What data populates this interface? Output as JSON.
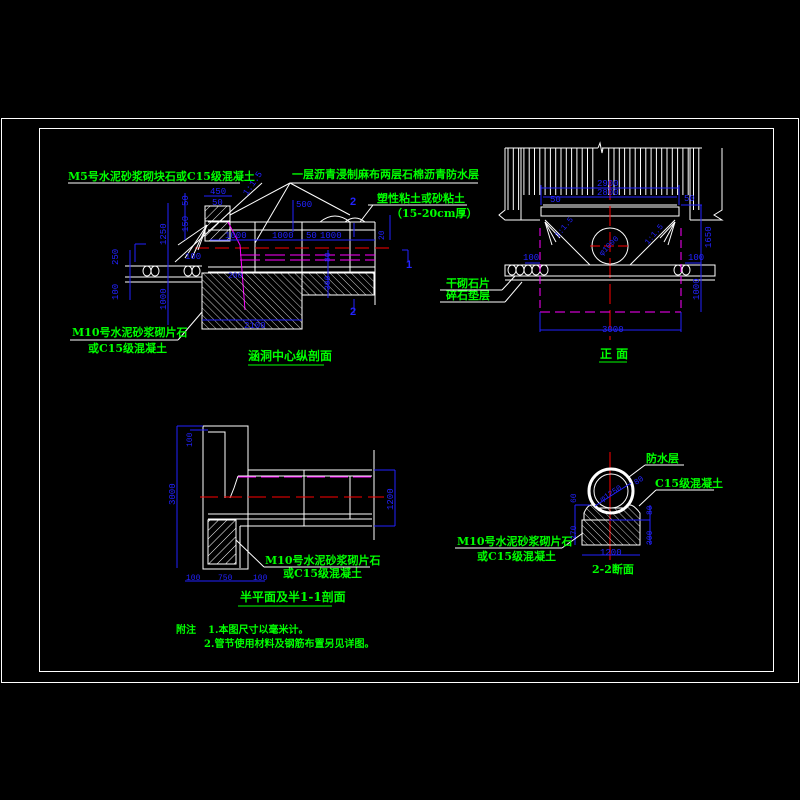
{
  "drawing": {
    "colors": {
      "background": "#000000",
      "outline": "#ffffff",
      "label": "#00ff00",
      "dimension": "#2222ff",
      "centerline": "#ff0000",
      "hidden": "#ff00ff"
    },
    "longitudinal_section": {
      "title": "涵洞中心纵剖面",
      "labels": {
        "top_left": "M5号水泥砂浆砌块石或C15级混凝土",
        "top_right": "一层沥青浸制麻布两层石棉沥青防水层",
        "fill_line1": "塑性粘土或砂粘土",
        "fill_line2": "（15-20cm厚）",
        "bottom_line1": "M10号水泥砂浆砌片石",
        "bottom_line2": "或C15级混凝土"
      },
      "slope": "1:1.5",
      "dims": {
        "d450": "450",
        "d50a": "50",
        "d50b": "50",
        "d150": "150",
        "d1250": "1250",
        "d250": "250",
        "d100a": "100",
        "d100b": "100",
        "d1000v": "1000",
        "d1000a": "1000",
        "d1000b": "1000",
        "d50c": "50",
        "d1000c": "1000",
        "d500": "500",
        "d20": "20",
        "d80": "80",
        "d300": "300",
        "d200": "200",
        "d2100": "2100"
      },
      "section_marks": {
        "s1": "1",
        "s2": "2"
      }
    },
    "front_view": {
      "title": "正  面",
      "labels": {
        "layer1": "干砌石片",
        "layer2": "碎石垫层"
      },
      "dims": {
        "d2900": "2900",
        "d2800": "2800",
        "d50l": "50",
        "d50r": "50",
        "d1650": "1650",
        "d100l": "100",
        "d100r": "100",
        "d1000": "1000",
        "d3000": "3000",
        "pipe": "φ1000"
      },
      "slope": "1:1.5"
    },
    "half_plan": {
      "title": "半平面及半1-1剖面",
      "labels": {
        "line1": "M10号水泥砂浆砌片石",
        "line2": "或C15级混凝土"
      },
      "dims": {
        "d3000": "3000",
        "d100t": "100",
        "d1200": "1200",
        "d100l": "100",
        "d750": "750",
        "d100r": "100"
      }
    },
    "section_2_2": {
      "title": "2-2断面",
      "labels": {
        "waterproof": "防水层",
        "concrete": "C15级混凝土",
        "line1": "M10号水泥砂浆砌片石",
        "line2": "或C15级混凝土"
      },
      "dims": {
        "pipe": "φ1250",
        "d80": "80",
        "d60": "60",
        "d80r": "80",
        "d270": "270",
        "d300": "300",
        "d1200": "1200"
      }
    },
    "notes": {
      "prefix": "附注",
      "items": [
        "1.本图尺寸以毫米计。",
        "2.管节使用材料及钢筋布置另见详图。"
      ]
    }
  }
}
